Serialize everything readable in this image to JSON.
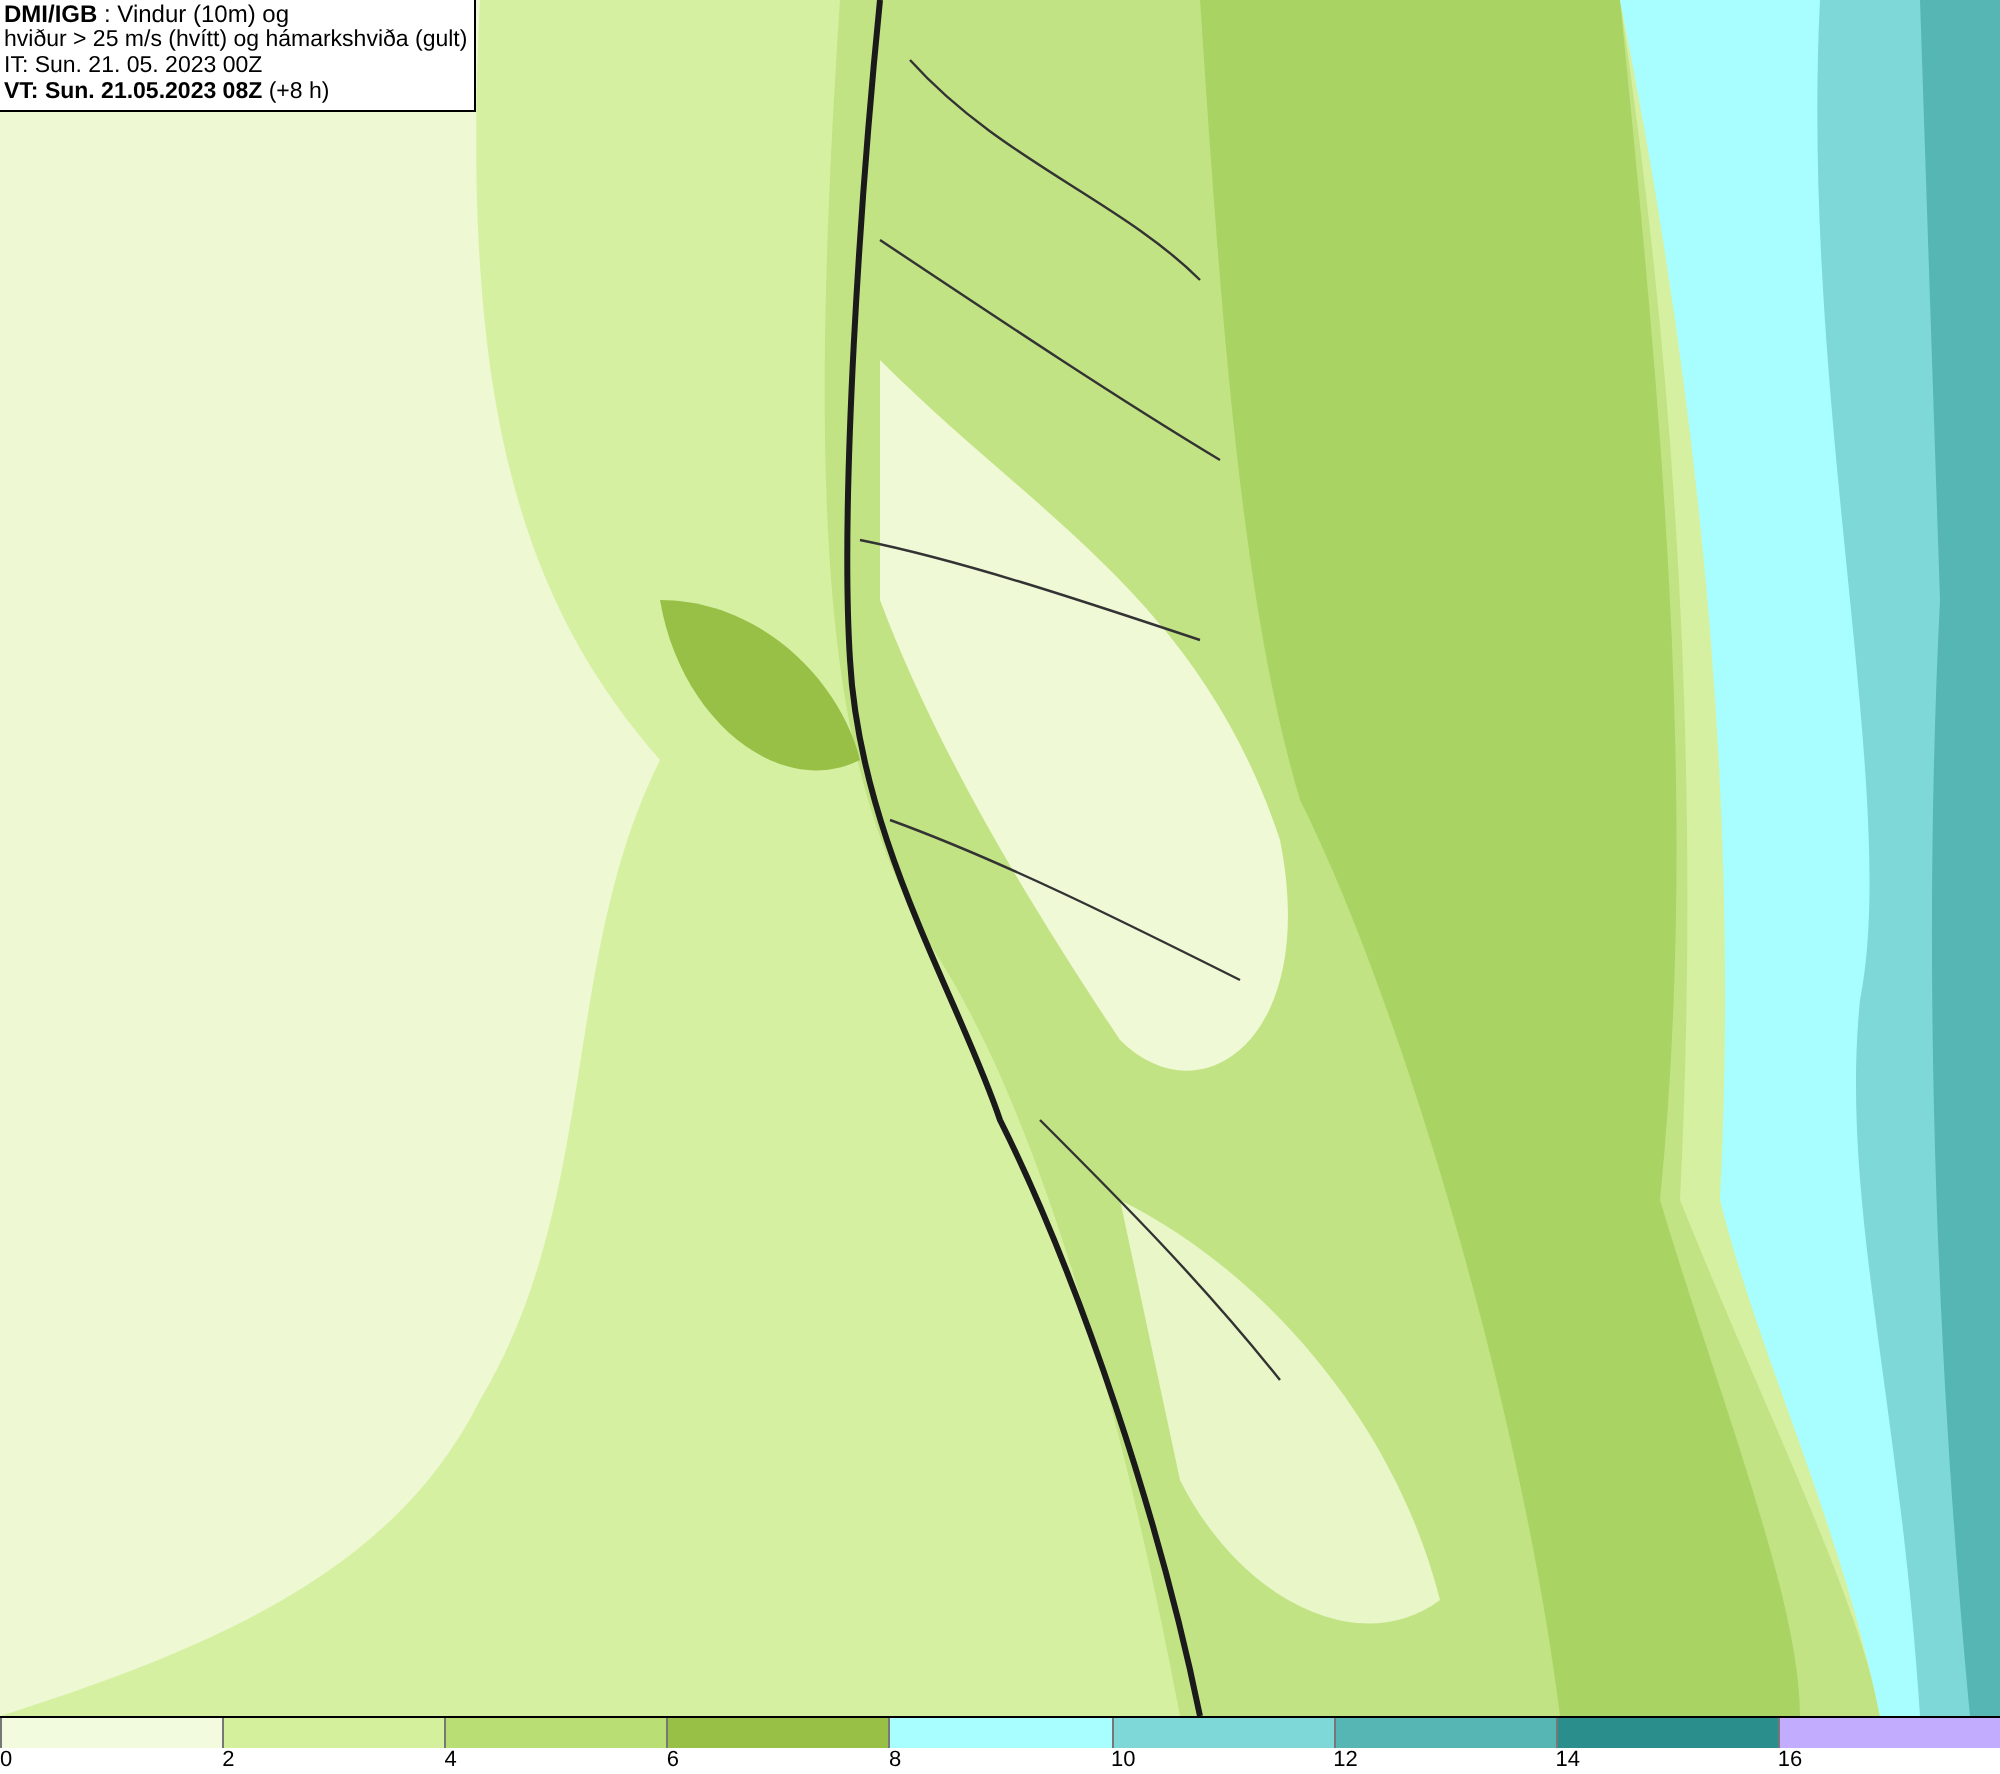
{
  "header": {
    "lines": [
      "**DMI/IGB** : Vindur (10m) og",
      "hviður > 25 m/s (hvítt) og hámarkshviða (gult)",
      "IT: Sun. 21. 05. 2023 00Z",
      "**VT: Sun. 21.05.2023 08Z** (+8 h)"
    ]
  },
  "legend": [
    {
      "label": "0",
      "color": "#f3fbdf"
    },
    {
      "label": "2",
      "color": "#d4f09c"
    },
    {
      "label": "4",
      "color": "#b8de74"
    },
    {
      "label": "6",
      "color": "#98c046"
    },
    {
      "label": "8",
      "color": "#a8fefe"
    },
    {
      "label": "10",
      "color": "#7fd8d8"
    },
    {
      "label": "12",
      "color": "#56b6b4"
    },
    {
      "label": "14",
      "color": "#2a8f8c"
    },
    {
      "label": "16",
      "color": "#c2acfe"
    }
  ]
}
